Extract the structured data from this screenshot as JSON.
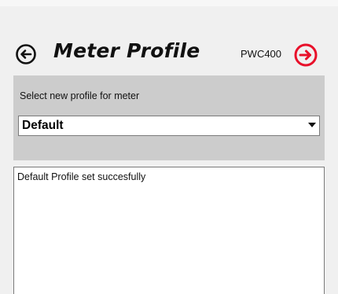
{
  "header": {
    "title": "Meter Profile",
    "device_label": "PWC400",
    "back_icon": "back-arrow-circle-icon",
    "forward_icon": "forward-arrow-circle-icon",
    "accent_color": "#e8102a"
  },
  "profile_panel": {
    "label": "Select new profile for meter",
    "selected_profile": "Default",
    "dropdown_icon": "chevron-down-icon"
  },
  "log": {
    "text": "Default Profile set succesfully"
  }
}
